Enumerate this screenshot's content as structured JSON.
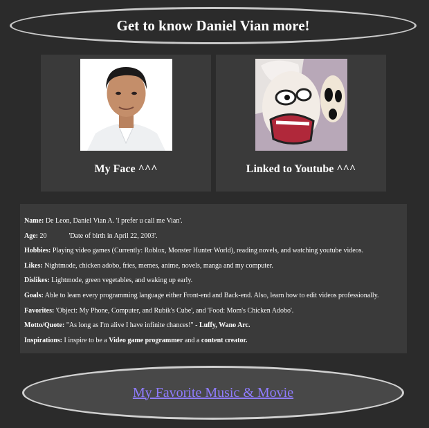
{
  "header": {
    "title": "Get to know Daniel Vian more!"
  },
  "cards": [
    {
      "caption": "My Face ^^^",
      "image": "portrait-photo"
    },
    {
      "caption": "Linked to Youtube ^^^",
      "image": "youtube-cartoon-thumbnail"
    }
  ],
  "info": {
    "name": {
      "label": "Name:",
      "value": "De Leon, Daniel Vian A. 'I prefer u call me Vian'."
    },
    "age": {
      "label": "Age:",
      "value": "20",
      "note": "'Date of birth in April 22, 2003'."
    },
    "hobbies": {
      "label": "Hobbies:",
      "value": "Playing video games (Currently: Roblox, Monster Hunter World), reading novels, and watching youtube videos."
    },
    "likes": {
      "label": "Likes:",
      "value": "Nightmode, chicken adobo, fries, memes, anime, novels, manga and my computer."
    },
    "dislikes": {
      "label": "Dislikes:",
      "value": "Lightmode, green vegetables, and waking up early."
    },
    "goals": {
      "label": "Goals:",
      "value": "Able to learn every programming language either Front-end and Back-end. Also, learn how to edit videos professionally."
    },
    "favorites": {
      "label": "Favorites:",
      "value": "'Object: My Phone, Computer, and Rubik's Cube', and 'Food: Mom's Chicken Adobo'."
    },
    "motto": {
      "label": "Motto/Quote:",
      "value": "\"As long as I'm alive I have infinite chances!\"",
      "attribution": " - Luffy, Wano Arc."
    },
    "inspirations": {
      "label": "Inspirations:",
      "pre": "I inspire to be a ",
      "b1": "Video game programmer",
      "mid": " and a ",
      "b2": "content creator."
    }
  },
  "footer": {
    "link_text": "My Favorite Music & Movie"
  },
  "colors": {
    "background": "#2b2b2b",
    "panel": "#3a3a3a",
    "link": "#8f7cff"
  }
}
